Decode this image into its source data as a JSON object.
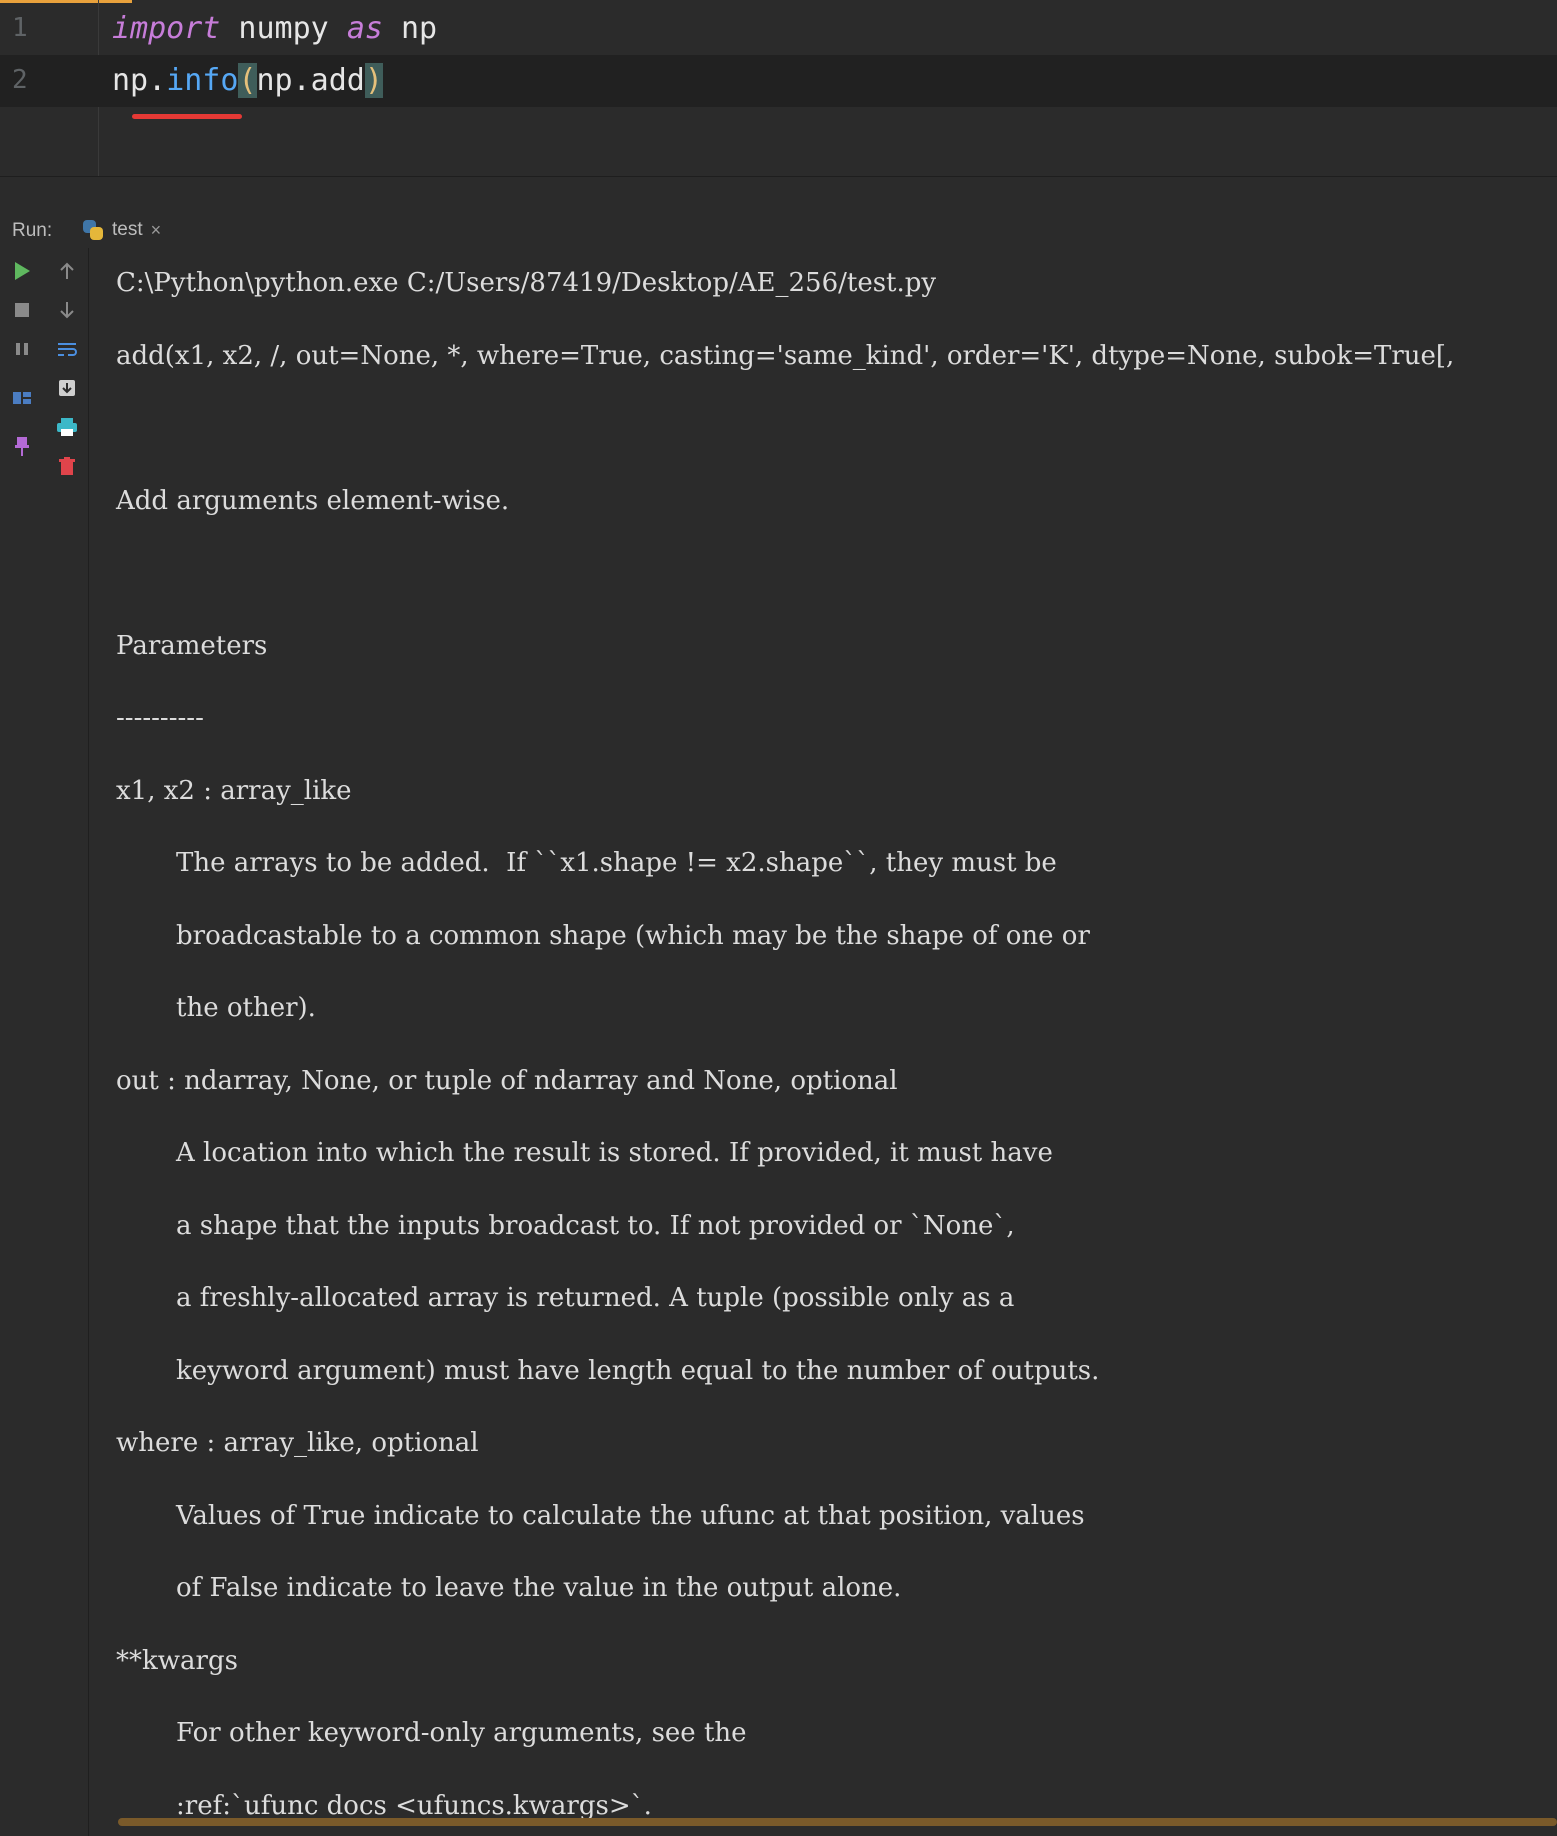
{
  "editor": {
    "lines": [
      {
        "number": "1",
        "kw1": "import",
        "mod": " numpy ",
        "kw2": "as",
        "alias": " np"
      },
      {
        "number": "2",
        "obj": "np.",
        "fn": "info",
        "open": "(",
        "arg": "np.add",
        "close": ")"
      }
    ]
  },
  "run": {
    "label": "Run:",
    "tab_name": "test",
    "tab_close": "×"
  },
  "toolbar": {
    "icons": [
      "play-icon",
      "stop-icon",
      "pause-icon",
      "layout-icon",
      "pin-icon",
      "scroll-up-icon",
      "scroll-down-icon",
      "soft-wrap-icon",
      "save-output-icon",
      "print-icon",
      "trash-icon"
    ]
  },
  "console": {
    "lines": [
      {
        "text": "C:\\Python\\python.exe C:/Users/87419/Desktop/AE_256/test.py",
        "indent": false
      },
      {
        "text": "add(x1, x2, /, out=None, *, where=True, casting='same_kind', order='K', dtype=None, subok=True[,",
        "indent": false
      },
      {
        "text": "",
        "indent": false
      },
      {
        "text": "Add arguments element-wise.",
        "indent": false
      },
      {
        "text": "",
        "indent": false
      },
      {
        "text": "Parameters",
        "indent": false
      },
      {
        "text": "----------",
        "indent": false
      },
      {
        "text": "x1, x2 : array_like",
        "indent": false
      },
      {
        "text": "The arrays to be added.  If ``x1.shape != x2.shape``, they must be",
        "indent": true
      },
      {
        "text": "broadcastable to a common shape (which may be the shape of one or",
        "indent": true
      },
      {
        "text": "the other).",
        "indent": true
      },
      {
        "text": "out : ndarray, None, or tuple of ndarray and None, optional",
        "indent": false
      },
      {
        "text": "A location into which the result is stored. If provided, it must have",
        "indent": true
      },
      {
        "text": "a shape that the inputs broadcast to. If not provided or `None`,",
        "indent": true
      },
      {
        "text": "a freshly-allocated array is returned. A tuple (possible only as a",
        "indent": true
      },
      {
        "text": "keyword argument) must have length equal to the number of outputs.",
        "indent": true
      },
      {
        "text": "where : array_like, optional",
        "indent": false
      },
      {
        "text": "Values of True indicate to calculate the ufunc at that position, values",
        "indent": true
      },
      {
        "text": "of False indicate to leave the value in the output alone.",
        "indent": true
      },
      {
        "text": "**kwargs",
        "indent": false
      },
      {
        "text": "For other keyword-only arguments, see the",
        "indent": true
      },
      {
        "text": ":ref:`ufunc docs <ufuncs.kwargs>`.",
        "indent": true
      }
    ]
  },
  "colors": {
    "background": "#2b2b2b",
    "keyword": "#c77dd9",
    "function": "#56a8f5",
    "paren_highlight": "#e5c07b",
    "error_underline": "#e53935",
    "run_green": "#5fb85f",
    "trash_red": "#e0444b"
  }
}
